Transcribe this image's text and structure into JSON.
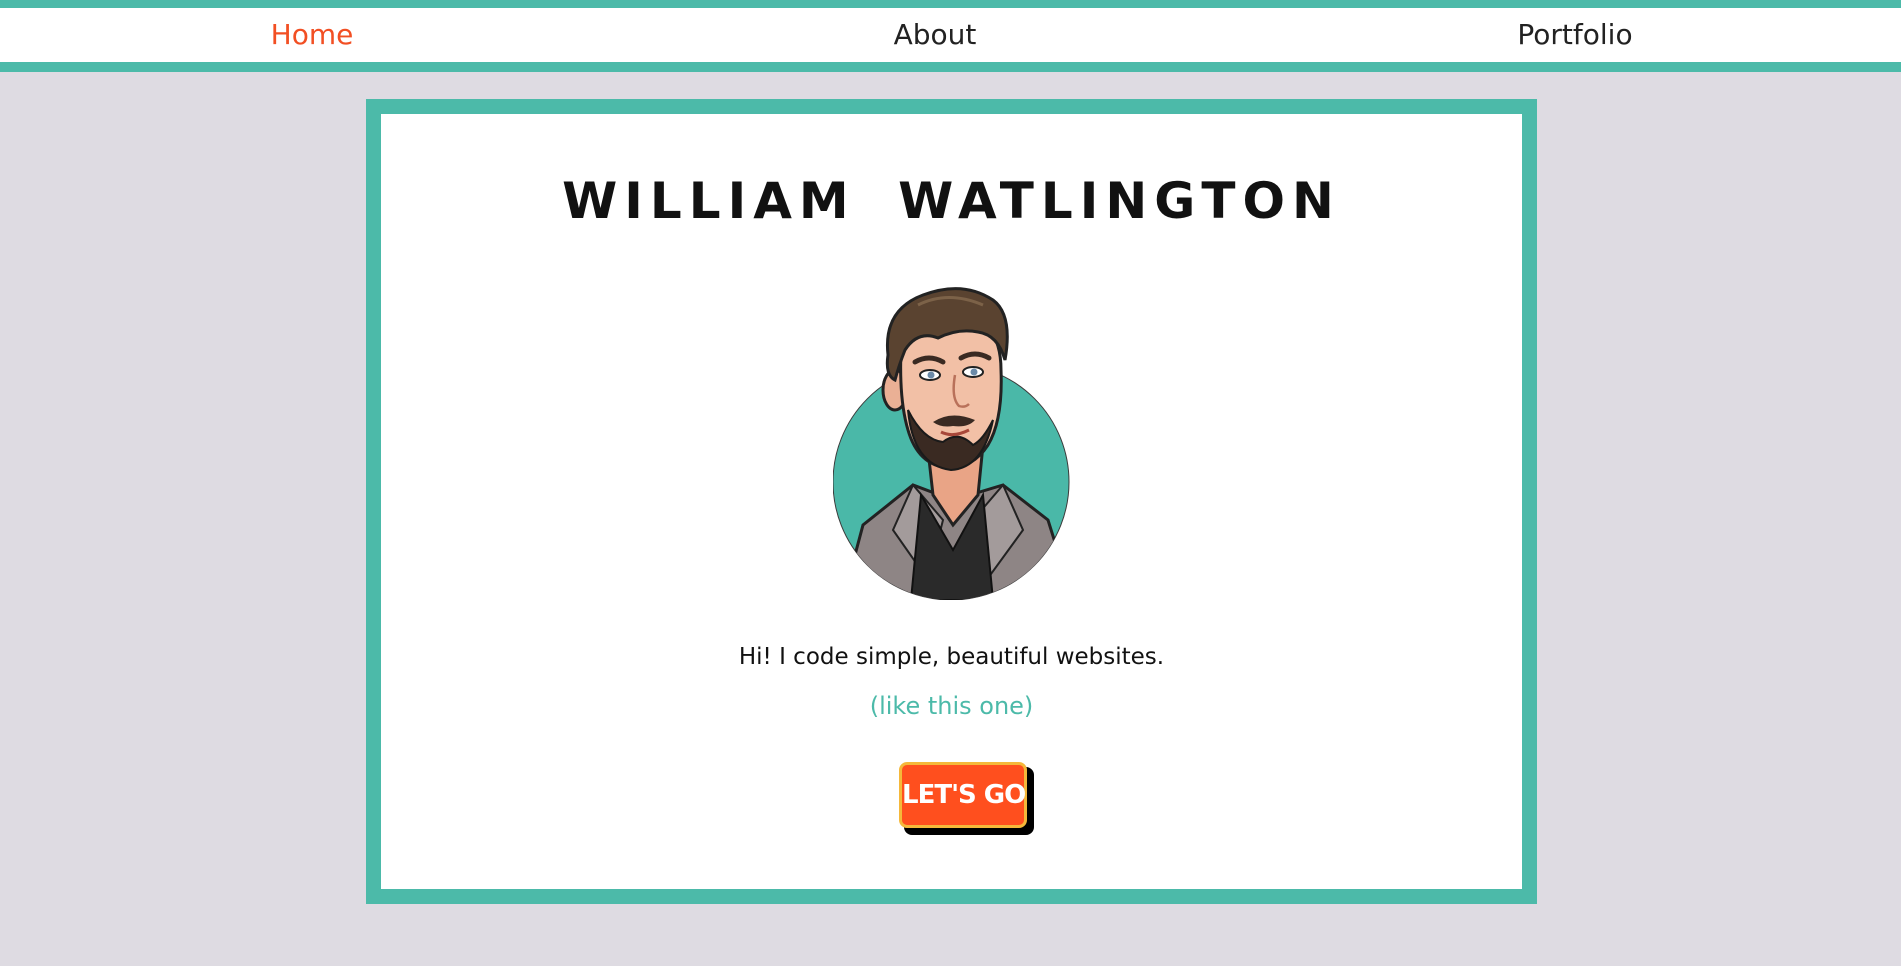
{
  "nav": {
    "items": [
      {
        "label": "Home",
        "active": true
      },
      {
        "label": "About",
        "active": false
      },
      {
        "label": "Portfolio",
        "active": false
      }
    ]
  },
  "hero": {
    "name": "WILLIAM  WATLINGTON",
    "avatar": "cartoon-portrait-avatar",
    "tagline": "Hi! I code simple, beautiful websites.",
    "subtagline": "(like this one)",
    "cta_label": "LET'S GO"
  },
  "colors": {
    "accent": "#4cbaa9",
    "active_link": "#f24f23",
    "button": "#ff4f1e",
    "button_border": "#f5b83a",
    "background": "#dedbe2"
  }
}
